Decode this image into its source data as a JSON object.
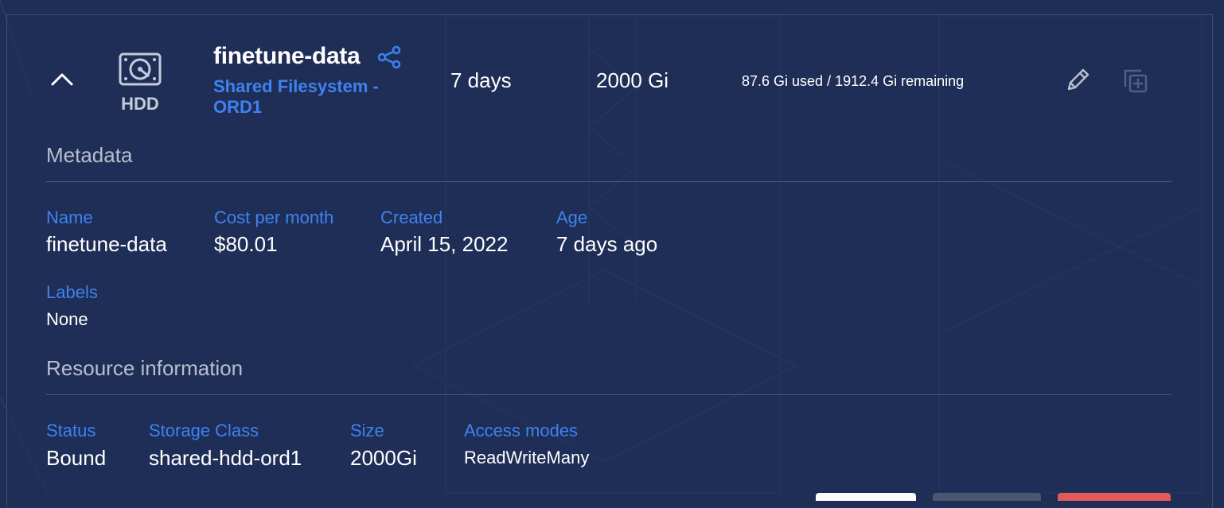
{
  "volume": {
    "name": "finetune-data",
    "drive_type": "HDD",
    "subtitle": "Shared Filesystem - ORD1",
    "retention": "7 days",
    "size": "2000 Gi",
    "usage": "87.6 Gi used / 1912.4 Gi remaining"
  },
  "metadata": {
    "title": "Metadata",
    "fields": [
      {
        "label": "Name",
        "value": "finetune-data"
      },
      {
        "label": "Cost per month",
        "value": "$80.01"
      },
      {
        "label": "Created",
        "value": "April 15, 2022"
      },
      {
        "label": "Age",
        "value": "7 days ago"
      }
    ],
    "labels_label": "Labels",
    "labels_value": "None"
  },
  "resource": {
    "title": "Resource information",
    "fields": [
      {
        "label": "Status",
        "value": "Bound"
      },
      {
        "label": "Storage Class",
        "value": "shared-hdd-ord1"
      },
      {
        "label": "Size",
        "value": "2000Gi"
      },
      {
        "label": "Access modes",
        "value": "ReadWriteMany"
      }
    ]
  },
  "icons": {
    "collapse": "chevron-up-icon",
    "drive": "hard-drive-icon",
    "share": "share-icon",
    "edit": "pencil-icon",
    "clone": "copy-add-icon"
  },
  "colors": {
    "background": "#1e2e54",
    "accent": "#3e82f0",
    "muted": "#b7bfcd"
  }
}
